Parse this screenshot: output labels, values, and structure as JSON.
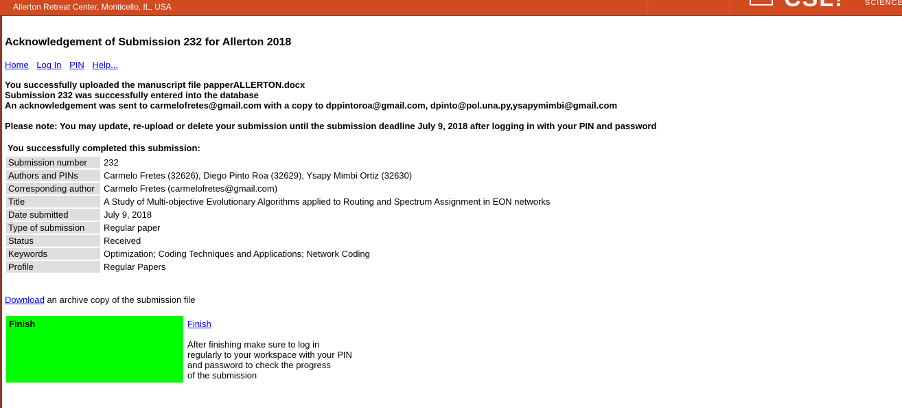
{
  "banner": {
    "location": "Allerton Retreat Center, Monticello, IL, USA",
    "logo_text": "CSL!",
    "logo_sub": "SCIENCE LA",
    "background_color": "#d24a20"
  },
  "page": {
    "title": "Acknowledgement of Submission 232 for Allerton 2018"
  },
  "nav": {
    "home": "Home",
    "login": "Log In",
    "pin": "PIN",
    "help": "Help..."
  },
  "messages": {
    "line1": "You successfully uploaded the manuscript file papperALLERTON.docx",
    "line2": "Submission 232 was successfully entered into the database",
    "line3": "An acknowledgement was sent to carmelofretes@gmail.com with a copy to dppintoroa@gmail.com, dpinto@pol.una.py,ysapymimbi@gmail.com"
  },
  "note": "Please note: You may update, re-upload or delete your submission until the submission deadline July 9, 2018 after logging in with your PIN and password",
  "completed": "You successfully completed this submission:",
  "details": [
    {
      "label": "Submission number",
      "value": "232"
    },
    {
      "label": "Authors and PINs",
      "value": "Carmelo Fretes (32626), Diego Pinto Roa (32629), Ysapy Mimbi Ortiz (32630)"
    },
    {
      "label": "Corresponding author",
      "value": "Carmelo Fretes (carmelofretes@gmail.com)"
    },
    {
      "label": "Title",
      "value": "A Study of Multi-objective Evolutionary Algorithms applied to Routing and Spectrum Assignment in EON networks"
    },
    {
      "label": "Date submitted",
      "value": "July 9, 2018"
    },
    {
      "label": "Type of submission",
      "value": "Regular paper"
    },
    {
      "label": "Status",
      "value": "Received"
    },
    {
      "label": "Keywords",
      "value": "Optimization; Coding Techniques and Applications; Network Coding"
    },
    {
      "label": "Profile",
      "value": "Regular Papers"
    }
  ],
  "download": {
    "link": "Download",
    "text": " an archive copy of the submission file"
  },
  "finish": {
    "box_label": "Finish",
    "link": "Finish",
    "text_lines": [
      "After finishing make sure to log in",
      "regularly to your workspace with your PIN",
      "and password to check the progress",
      "of the submission"
    ],
    "box_color": "#00ff00"
  }
}
